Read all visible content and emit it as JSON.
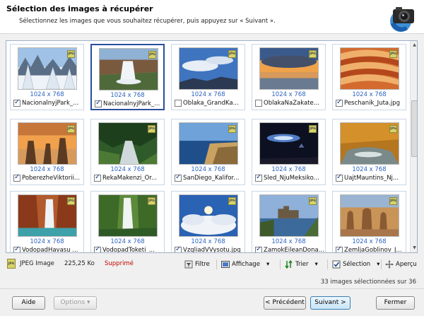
{
  "header": {
    "title": "Sélection des images à récupérer",
    "subtitle": "Sélectionnez les images que vous souhaitez récupérer, puis appuyez sur « Suivant »."
  },
  "grid": {
    "items": [
      {
        "name": "NacionalnyjPark_...",
        "dims": "1024 x 768",
        "checked": true,
        "scene": "snow"
      },
      {
        "name": "NacionalnyjPark_...",
        "dims": "1024 x 768",
        "checked": true,
        "scene": "waterfall"
      },
      {
        "name": "Oblaka_GrandKa...",
        "dims": "1024 x 768",
        "checked": false,
        "scene": "sky"
      },
      {
        "name": "OblakaNaZakate...",
        "dims": "1024 x 768",
        "checked": false,
        "scene": "sunset"
      },
      {
        "name": "Peschanik_Juta.jpg",
        "dims": "1024 x 768",
        "checked": true,
        "scene": "sandstone"
      },
      {
        "name": "PoberezheViktorii...",
        "dims": "1024 x 768",
        "checked": true,
        "scene": "coast_sunset"
      },
      {
        "name": "RekaMakenzi_Or...",
        "dims": "1024 x 768",
        "checked": true,
        "scene": "forest"
      },
      {
        "name": "SanDiego_Kalifor...",
        "dims": "1024 x 768",
        "checked": true,
        "scene": "bay"
      },
      {
        "name": "Sled_NjuMeksiko...",
        "dims": "1024 x 768",
        "checked": true,
        "scene": "night"
      },
      {
        "name": "UajtMauntins_Nj...",
        "dims": "1024 x 768",
        "checked": true,
        "scene": "autumn"
      },
      {
        "name": "VodopadHavasu ...",
        "dims": "1024 x 768",
        "checked": true,
        "scene": "canyon_falls"
      },
      {
        "name": "VodopadToketi_...",
        "dims": "1024 x 768",
        "checked": true,
        "scene": "green_falls"
      },
      {
        "name": "VzgliadVVysotu.jpg",
        "dims": "1024 x 768",
        "checked": true,
        "scene": "clouds"
      },
      {
        "name": "ZamokEileanDona...",
        "dims": "1024 x 768",
        "checked": true,
        "scene": "castle"
      },
      {
        "name": "ZemljaGoblinov_J...",
        "dims": "1024 x 768",
        "checked": true,
        "scene": "hoodoos"
      }
    ]
  },
  "statusbar": {
    "file_type": "JPEG Image",
    "file_size": "225,25 Ko",
    "file_state": "Supprimé",
    "file_icon_text": "JPG",
    "filter_label": "Filtre",
    "view_label": "Affichage",
    "sort_label": "Trier",
    "selection_label": "Sélection",
    "preview_label": "Aperçu"
  },
  "summary": "33 images sélectionnées sur 36",
  "buttons": {
    "help": "Aide",
    "options": "Options ▾",
    "previous": "< Précédent",
    "next": "Suivant >",
    "close": "Fermer"
  },
  "colors": {
    "accent": "#2a4f9e",
    "dims_text": "#2d63c0",
    "deleted": "#c00000"
  },
  "badge_text": "JPG"
}
